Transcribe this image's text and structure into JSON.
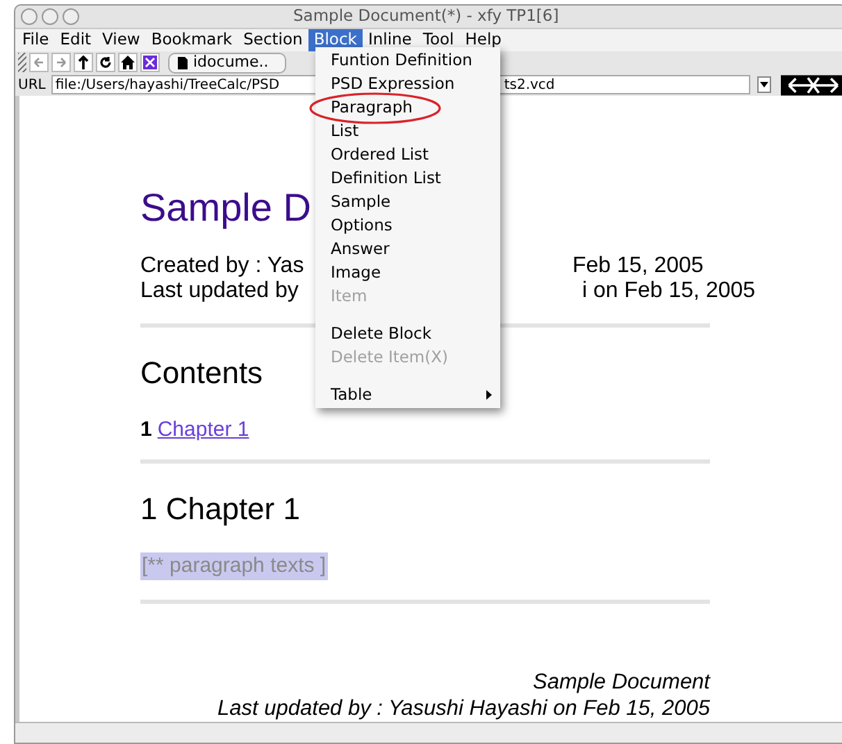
{
  "window": {
    "title": "Sample Document(*) - xfy TP1[6]"
  },
  "menubar": [
    {
      "label": "File",
      "selected": false
    },
    {
      "label": "Edit",
      "selected": false
    },
    {
      "label": "View",
      "selected": false
    },
    {
      "label": "Bookmark",
      "selected": false
    },
    {
      "label": "Section",
      "selected": false
    },
    {
      "label": "Block",
      "selected": true
    },
    {
      "label": "Inline",
      "selected": false
    },
    {
      "label": "Tool",
      "selected": false
    },
    {
      "label": "Help",
      "selected": false
    }
  ],
  "toolbar": {
    "tab_label": "idocume.."
  },
  "url_bar": {
    "label": "URL",
    "value": "file:/Users/hayashi/TreeCalc/PSD",
    "value_tail": "ts2.vcd"
  },
  "document": {
    "title": "Sample D",
    "meta": [
      {
        "left": "Created by : Yas",
        "right": "Feb 15, 2005"
      },
      {
        "left": "Last updated by",
        "right": "i on Feb 15, 2005"
      }
    ],
    "contents_heading": "Contents",
    "toc": [
      {
        "number": "1",
        "link": "Chapter 1"
      }
    ],
    "chapter_heading": "1 Chapter 1",
    "paragraph": "[** paragraph texts ]",
    "footer": [
      "Sample Document",
      "Last updated by : Yasushi Hayashi on Feb 15, 2005"
    ]
  },
  "block_menu": [
    {
      "kind": "item",
      "label": "Funtion Definition",
      "disabled": false
    },
    {
      "kind": "item",
      "label": "PSD Expression",
      "disabled": false
    },
    {
      "kind": "item",
      "label": "Paragraph",
      "disabled": false,
      "circled": true
    },
    {
      "kind": "item",
      "label": "List",
      "disabled": false
    },
    {
      "kind": "item",
      "label": "Ordered List",
      "disabled": false
    },
    {
      "kind": "item",
      "label": "Definition List",
      "disabled": false
    },
    {
      "kind": "item",
      "label": "Sample",
      "disabled": false
    },
    {
      "kind": "item",
      "label": "Options",
      "disabled": false
    },
    {
      "kind": "item",
      "label": "Answer",
      "disabled": false
    },
    {
      "kind": "item",
      "label": "Image",
      "disabled": false
    },
    {
      "kind": "item",
      "label": "Item",
      "disabled": true
    },
    {
      "kind": "separator"
    },
    {
      "kind": "item",
      "label": "Delete Block",
      "disabled": false
    },
    {
      "kind": "item",
      "label": "Delete Item(X)",
      "disabled": true
    },
    {
      "kind": "separator"
    },
    {
      "kind": "submenu",
      "label": "Table",
      "disabled": false
    }
  ]
}
